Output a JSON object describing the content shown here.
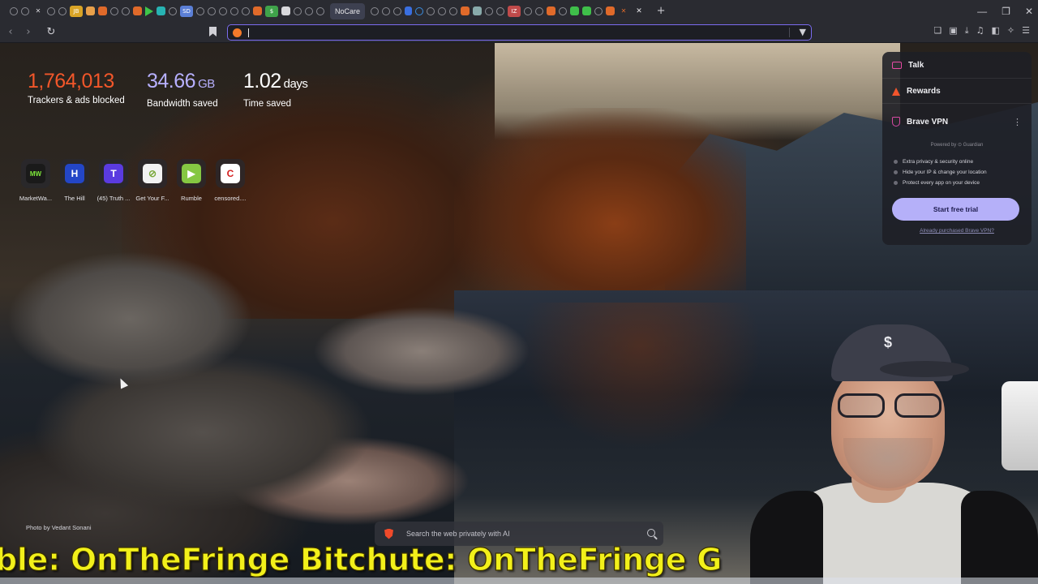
{
  "tabs": {
    "active_label": "NoCare",
    "icons": [
      {
        "icon": "globe-icon",
        "color": "#8a8b92"
      },
      {
        "icon": "globe-icon",
        "color": "#8a8b92"
      },
      {
        "icon": "x-icon",
        "color": "#d8d8dc"
      },
      {
        "icon": "globe-icon",
        "color": "#8a8b92"
      },
      {
        "icon": "globe-icon",
        "color": "#8a8b92"
      },
      {
        "icon": "jb-icon",
        "color": "#d9a426",
        "label": "JB"
      },
      {
        "icon": "doc-icon",
        "color": "#e8a04a"
      },
      {
        "icon": "doc-icon",
        "color": "#e06a2a"
      },
      {
        "icon": "globe-icon",
        "color": "#8a8b92"
      },
      {
        "icon": "globe-icon",
        "color": "#8a8b92"
      },
      {
        "icon": "doc-icon",
        "color": "#e06a2a"
      },
      {
        "icon": "play-icon",
        "color": "#3ec54a"
      },
      {
        "icon": "grid-icon",
        "color": "#27b3b3"
      },
      {
        "icon": "globe-icon",
        "color": "#8a8b92"
      },
      {
        "icon": "sd-icon",
        "color": "#5b7fd6",
        "label": "SD"
      },
      {
        "icon": "globe-icon",
        "color": "#8a8b92"
      },
      {
        "icon": "globe-icon",
        "color": "#8a8b92"
      },
      {
        "icon": "globe-icon",
        "color": "#8a8b92"
      },
      {
        "icon": "globe-icon",
        "color": "#8a8b92"
      },
      {
        "icon": "globe-icon",
        "color": "#8a8b92"
      },
      {
        "icon": "doc-icon",
        "color": "#e06a2a"
      },
      {
        "icon": "dollar-icon",
        "color": "#3fa34a",
        "label": "$"
      },
      {
        "icon": "image-icon",
        "color": "#d8d8dc"
      },
      {
        "icon": "globe-icon",
        "color": "#8a8b92"
      },
      {
        "icon": "globe-icon",
        "color": "#8a8b92"
      },
      {
        "icon": "globe-icon",
        "color": "#8a8b92"
      }
    ],
    "icons_after": [
      {
        "icon": "globe-icon",
        "color": "#8a8b92"
      },
      {
        "icon": "globe-icon",
        "color": "#8a8b92"
      },
      {
        "icon": "globe-icon",
        "color": "#8a8b92"
      },
      {
        "icon": "pause-icon",
        "color": "#3a6fe0"
      },
      {
        "icon": "globe-icon",
        "color": "#3a8de0"
      },
      {
        "icon": "globe-icon",
        "color": "#8a8b92"
      },
      {
        "icon": "globe-icon",
        "color": "#8a8b92"
      },
      {
        "icon": "globe-icon",
        "color": "#8a8b92"
      },
      {
        "icon": "doc-icon",
        "color": "#e06a2a"
      },
      {
        "icon": "image-icon",
        "color": "#8aa"
      },
      {
        "icon": "globe-icon",
        "color": "#8a8b92"
      },
      {
        "icon": "globe-icon",
        "color": "#8a8b92"
      },
      {
        "icon": "iz-icon",
        "color": "#c04a4a",
        "label": "IZ"
      },
      {
        "icon": "globe-icon",
        "color": "#8a8b92"
      },
      {
        "icon": "globe-icon",
        "color": "#8a8b92"
      },
      {
        "icon": "doc-icon",
        "color": "#e06a2a"
      },
      {
        "icon": "globe-icon",
        "color": "#8a8b92"
      },
      {
        "icon": "grid-icon",
        "color": "#3fbf4a"
      },
      {
        "icon": "grid-icon",
        "color": "#3fbf4a"
      },
      {
        "icon": "globe-icon",
        "color": "#8a8b92"
      },
      {
        "icon": "doc-icon",
        "color": "#e06a2a"
      },
      {
        "icon": "x-icon",
        "color": "#e06a2a"
      }
    ],
    "close_glyph": "✕",
    "new_tab_glyph": "+"
  },
  "window": {
    "minimize": "—",
    "maximize": "❐",
    "close": "✕"
  },
  "toolbar": {
    "back": "‹",
    "forward": "›",
    "reload": "↻",
    "shield": "▼",
    "url_value": "",
    "right_icons": [
      "❏",
      "▣",
      "⤓",
      "♫",
      "◧",
      "✧",
      "☰"
    ]
  },
  "stats": {
    "trackers": {
      "value": "1,764,013",
      "label": "Trackers & ads blocked",
      "color": "#f2572a"
    },
    "bandwidth": {
      "value": "34.66",
      "unit": "GB",
      "label": "Bandwidth saved",
      "color": "#b7b0ff"
    },
    "time": {
      "value": "1.02",
      "unit": "days",
      "label": "Time saved",
      "color": "#ffffff"
    }
  },
  "top_sites": [
    {
      "label": "MarketWa...",
      "icon": "marketwatch-icon",
      "glyph": "MW",
      "bg": "#1a1a1a",
      "fg": "#7ee83a"
    },
    {
      "label": "The Hill",
      "icon": "thehill-icon",
      "glyph": "H",
      "bg": "#2346c7",
      "fg": "#ffffff"
    },
    {
      "label": "(45) Truth ...",
      "icon": "truthsocial-icon",
      "glyph": "T",
      "bg": "#5a3be0",
      "fg": "#ffffff"
    },
    {
      "label": "Get Your F...",
      "icon": "getyourf-icon",
      "glyph": "⊘",
      "bg": "#f2f2f2",
      "fg": "#7aa83a"
    },
    {
      "label": "Rumble",
      "icon": "rumble-icon",
      "glyph": "▶",
      "bg": "#85c742",
      "fg": "#ffffff"
    },
    {
      "label": "censored....",
      "icon": "censored-icon",
      "glyph": "C",
      "bg": "#ffffff",
      "fg": "#d42020"
    }
  ],
  "panel": {
    "talk": "Talk",
    "rewards": "Rewards",
    "vpn": "Brave VPN",
    "kebab": "⋮",
    "powered": "Powered by ⊙ Guardian",
    "bullets": [
      "Extra privacy & security online",
      "Hide your IP & change your location",
      "Protect every app on your device"
    ],
    "trial": "Start free trial",
    "already": "Already purchased Brave VPN?"
  },
  "credit": "Photo by Vedant Sonani",
  "search": {
    "placeholder": "Search the web privately with AI"
  },
  "banner": {
    "text": "ble: OnTheFringe Bitchute: OnTheFringe G"
  },
  "cam": {
    "cap_logo": "$"
  }
}
